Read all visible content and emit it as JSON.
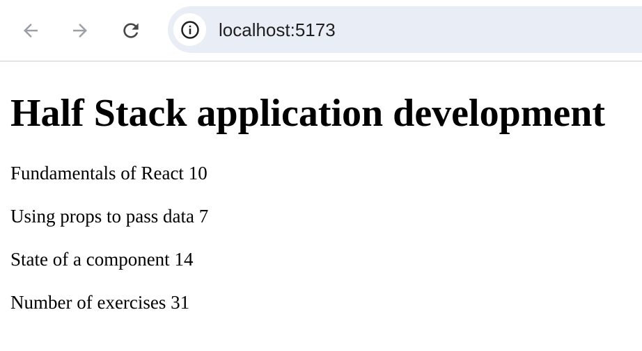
{
  "browser": {
    "url": "localhost:5173",
    "icons": {
      "back": "arrow-left-icon",
      "forward": "arrow-right-icon",
      "reload": "reload-icon",
      "site_info": "info-icon"
    }
  },
  "page": {
    "title": "Half Stack application development",
    "parts": [
      {
        "name": "Fundamentals of React",
        "exercises": "10"
      },
      {
        "name": "Using props to pass data",
        "exercises": "7"
      },
      {
        "name": "State of a component",
        "exercises": "14"
      }
    ],
    "total_label": "Number of exercises",
    "total": "31"
  },
  "colors": {
    "omnibox_bg": "#e9eef6",
    "disabled_icon": "#9aa0a6",
    "active_icon": "#474747"
  }
}
